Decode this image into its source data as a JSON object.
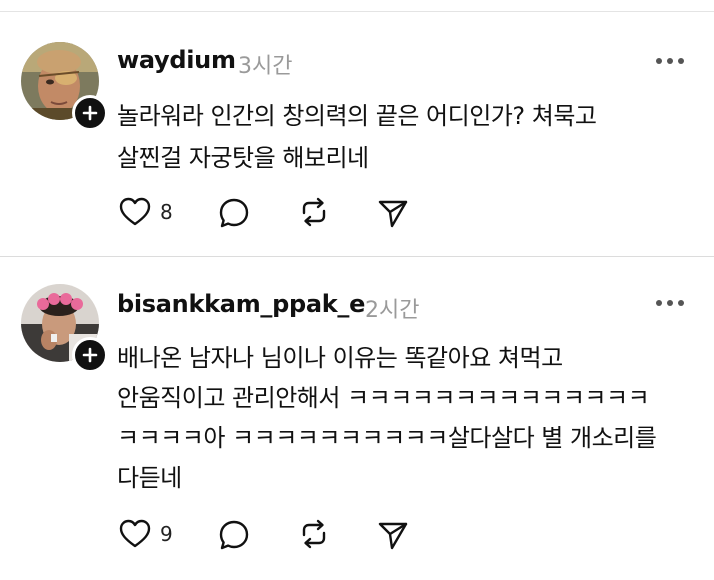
{
  "icons": {
    "more": "more-horizontal-icon",
    "like": "heart-outline-icon",
    "reply": "speech-bubble-icon",
    "repost": "repost-arrows-icon",
    "share": "send-paper-plane-icon",
    "follow": "plus-icon"
  },
  "colors": {
    "text": "#111111",
    "timestamp": "#9a9a9a",
    "divider": "#dcdcdc",
    "badge": "#111111"
  },
  "comments": [
    {
      "username": "waydium",
      "time": "3시간",
      "lines": [
        "놀라워라 인간의 창의력의 끝은 어디인가? 쳐묵고",
        "살찐걸 자궁탓을 해보리네"
      ],
      "likes": "8"
    },
    {
      "username": "bisankkam_ppak_e",
      "time": "2시간",
      "lines": [
        "배나온 남자나 님이나 이유는 똑같아요 쳐먹고",
        "안움직이고 관리안해서 ㅋㅋㅋㅋㅋㅋㅋㅋㅋㅋㅋㅋㅋㅋ",
        "ㅋㅋㅋㅋ아 ㅋㅋㅋㅋㅋㅋㅋㅋㅋㅋ살다살다 별 개소리를",
        "다듣네"
      ],
      "likes": "9"
    }
  ]
}
